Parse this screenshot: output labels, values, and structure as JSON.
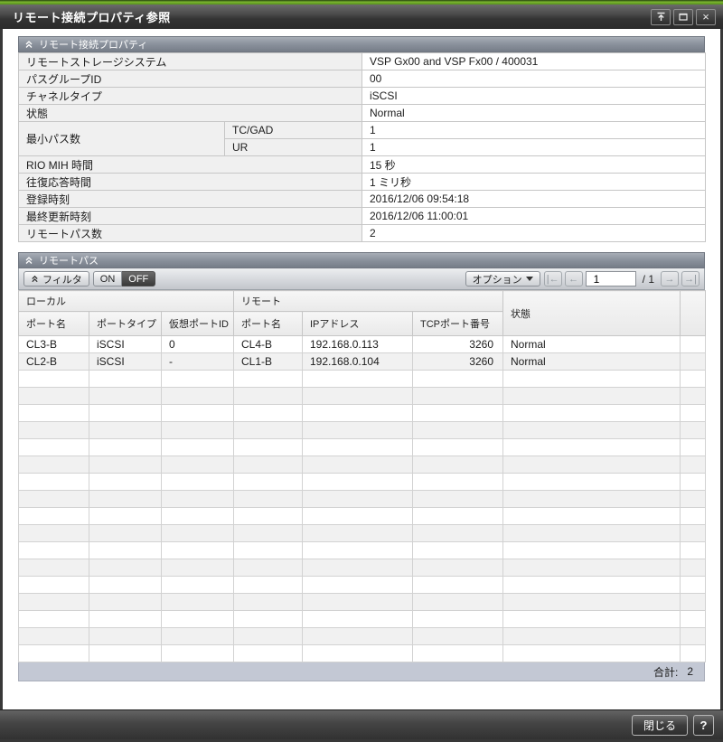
{
  "window": {
    "title": "リモート接続プロパティ参照",
    "controls": {
      "pin": "pin-window-icon",
      "maximize": "maximize-icon",
      "close": "×"
    }
  },
  "section1": {
    "title": "リモート接続プロパティ",
    "rows": [
      {
        "label": "リモートストレージシステム",
        "value": "VSP Gx00 and VSP Fx00 / 400031"
      },
      {
        "label": "パスグループID",
        "value": "00"
      },
      {
        "label": "チャネルタイプ",
        "value": "iSCSI"
      },
      {
        "label": "状態",
        "value": "Normal"
      },
      {
        "label": "最小パス数",
        "sublabel": "TC/GAD",
        "value": "1",
        "span": 2
      },
      {
        "sublabel": "UR",
        "value": "1",
        "cont": true
      },
      {
        "label": "RIO MIH 時間",
        "value": "15 秒"
      },
      {
        "label": "往復応答時間",
        "value": "1 ミリ秒"
      },
      {
        "label": "登録時刻",
        "value": "2016/12/06 09:54:18"
      },
      {
        "label": "最終更新時刻",
        "value": "2016/12/06 11:00:01"
      },
      {
        "label": "リモートパス数",
        "value": "2"
      }
    ]
  },
  "section2": {
    "title": "リモートパス",
    "toolbar": {
      "filter_label": "フィルタ",
      "on_label": "ON",
      "off_label": "OFF",
      "options_label": "オプション",
      "pager": {
        "first": "|←",
        "prev": "←",
        "page": "1",
        "of": "/ 1",
        "next": "→",
        "last": "→|"
      }
    },
    "table": {
      "groups": {
        "local": "ローカル",
        "remote": "リモート",
        "status": "状態"
      },
      "columns": [
        "ポート名",
        "ポートタイプ",
        "仮想ポートID",
        "ポート名",
        "IPアドレス",
        "TCPポート番号"
      ],
      "rows": [
        [
          "CL3-B",
          "iSCSI",
          "0",
          "CL4-B",
          "192.168.0.113",
          "3260",
          "Normal"
        ],
        [
          "CL2-B",
          "iSCSI",
          "-",
          "CL1-B",
          "192.168.0.104",
          "3260",
          "Normal"
        ]
      ],
      "empty_row_count": 17
    },
    "footer": {
      "total_label": "合計:",
      "total_value": "2"
    }
  },
  "footer_bar": {
    "close_label": "閉じる",
    "help_label": "?"
  },
  "colors": {
    "accent_green": "#7ab430",
    "section_header": "#8a919c",
    "grid_footer": "#c3c8d4",
    "row_stripe": "#f1f1f1"
  }
}
